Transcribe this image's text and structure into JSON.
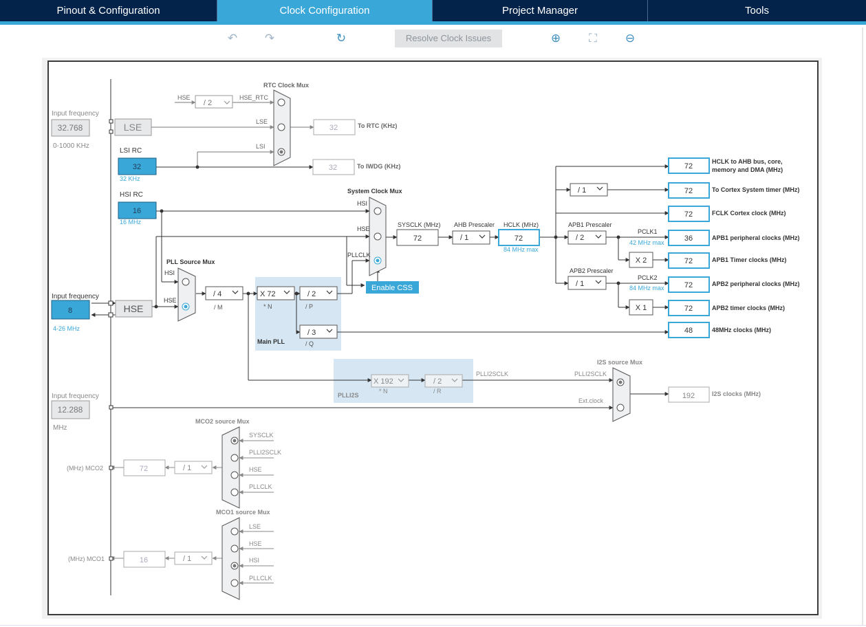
{
  "tabs": [
    {
      "label": "Pinout & Configuration",
      "active": false
    },
    {
      "label": "Clock Configuration",
      "active": true
    },
    {
      "label": "Project Manager",
      "active": false
    },
    {
      "label": "Tools",
      "active": false
    }
  ],
  "toolbar": {
    "resolve_label": "Resolve Clock Issues"
  },
  "left": {
    "lse_input_caption": "Input frequency",
    "lse_input_value": "32.768",
    "lse_range": "0-1000 KHz",
    "lse_label": "LSE",
    "lsi_caption": "LSI RC",
    "lsi_value": "32",
    "lsi_freq": "32 KHz",
    "hsi_caption": "HSI RC",
    "hsi_value": "16",
    "hsi_freq": "16 MHz",
    "hse_input_caption": "Input frequency",
    "hse_input_value": "8",
    "hse_range": "4-26 MHz",
    "hse_label": "HSE",
    "ext_input_caption": "Input frequency",
    "ext_input_value": "12.288",
    "ext_unit": "MHz"
  },
  "rtc": {
    "title": "RTC Clock Mux",
    "hse_label": "HSE",
    "hse_div": "/ 2",
    "hse_rtc": "HSE_RTC",
    "lse": "LSE",
    "lsi": "LSI",
    "rtc_out": "32",
    "rtc_caption": "To RTC (KHz)",
    "iwdg_out": "32",
    "iwdg_caption": "To IWDG (KHz)"
  },
  "pll": {
    "mux_title": "PLL Source Mux",
    "hsi": "HSI",
    "hse": "HSE",
    "m_value": "/ 4",
    "m_caption": "/ M",
    "n_value": "X 72",
    "n_caption": "* N",
    "p_value": "/ 2",
    "p_caption": "/ P",
    "q_value": "/ 3",
    "q_caption": "/ Q",
    "title": "Main PLL"
  },
  "sysmux": {
    "title": "System Clock Mux",
    "hsi": "HSI",
    "hse": "HSE",
    "pllclk": "PLLCLK",
    "enable_css": "Enable CSS",
    "sysclk_caption": "SYSCLK (MHz)",
    "sysclk_value": "72",
    "ahb_caption": "AHB Prescaler",
    "ahb_value": "/ 1",
    "hclk_caption": "HCLK (MHz)",
    "hclk_value": "72",
    "hclk_max": "84 MHz max"
  },
  "outputs": {
    "hclk_value": "72",
    "hclk_label_1": "HCLK to AHB bus, core,",
    "hclk_label_2": "memory and DMA (MHz)",
    "cortex_div": "/ 1",
    "cortex_value": "72",
    "cortex_label": "To Cortex System timer (MHz)",
    "fclk_value": "72",
    "fclk_label": "FCLK Cortex clock (MHz)",
    "apb1_caption": "APB1 Prescaler",
    "apb1_div": "/ 2",
    "pclk1": "PCLK1",
    "pclk1_max": "42 MHz max",
    "apb1_periph_value": "36",
    "apb1_periph_label": "APB1 peripheral clocks (MHz)",
    "apb1_timer_mult": "X 2",
    "apb1_timer_value": "72",
    "apb1_timer_label": "APB1 Timer clocks (MHz)",
    "apb2_caption": "APB2 Prescaler",
    "apb2_div": "/ 1",
    "pclk2": "PCLK2",
    "pclk2_max": "84 MHz max",
    "apb2_periph_value": "72",
    "apb2_periph_label": "APB2 peripheral clocks (MHz)",
    "apb2_timer_mult": "X 1",
    "apb2_timer_value": "72",
    "apb2_timer_label": "APB2 timer clocks (MHz)",
    "mhz48_value": "48",
    "mhz48_label": "48MHz clocks (MHz)"
  },
  "plli2s": {
    "n_value": "X 192",
    "n_caption": "* N",
    "r_value": "/ 2",
    "r_caption": "/ R",
    "title": "PLLI2S",
    "out_label": "PLLI2SCLK",
    "mux_title": "I2S source Mux",
    "mux_in1": "PLLI2SCLK",
    "mux_in2": "Ext.clock",
    "i2s_value": "192",
    "i2s_label": "I2S clocks (MHz)"
  },
  "mco2": {
    "title": "MCO2 source Mux",
    "in1": "SYSCLK",
    "in2": "PLLI2SCLK",
    "in3": "HSE",
    "in4": "PLLCLK",
    "div": "/ 1",
    "value": "72",
    "label": "(MHz) MCO2"
  },
  "mco1": {
    "title": "MCO1 source Mux",
    "in1": "LSE",
    "in2": "HSE",
    "in3": "HSI",
    "in4": "PLLCLK",
    "div": "/ 1",
    "value": "16",
    "label": "(MHz) MCO1"
  },
  "colors": {
    "accent": "#3aa7d9",
    "navy": "#03234b",
    "pll_region": "#d6e6f3"
  }
}
